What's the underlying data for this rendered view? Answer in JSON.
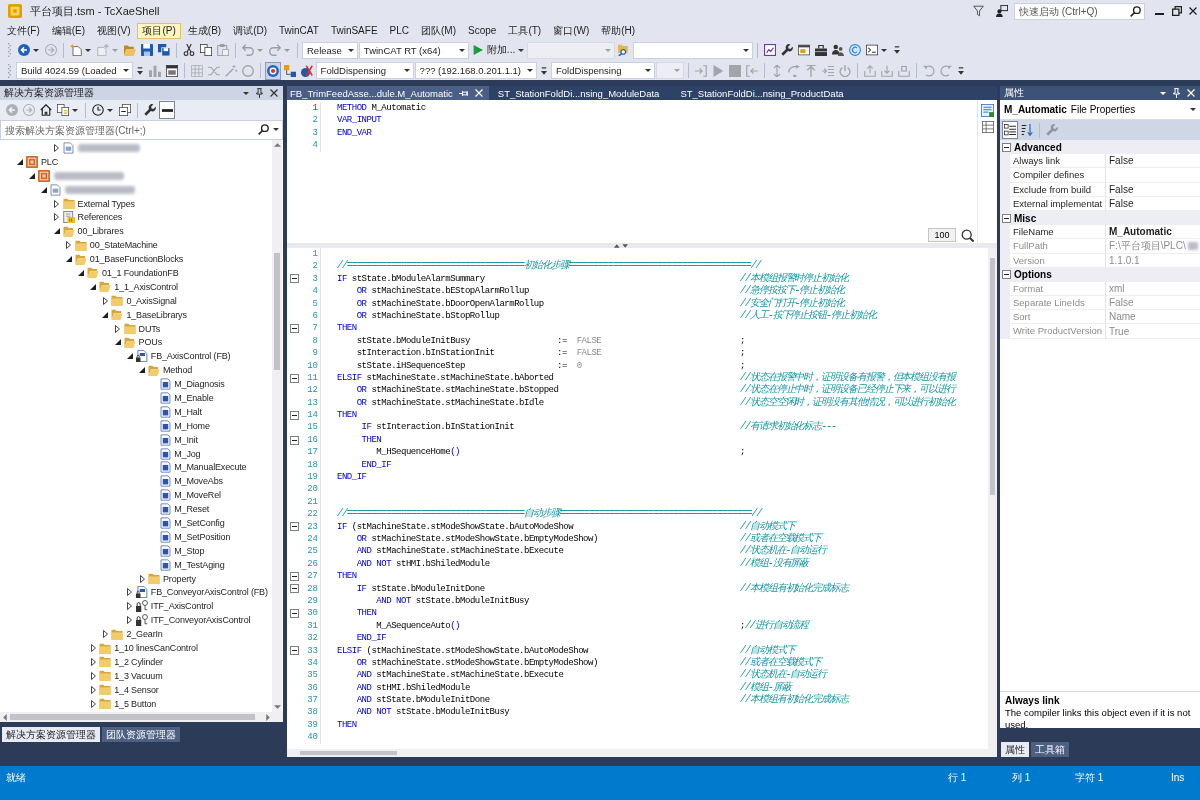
{
  "window": {
    "title": "平台项目.tsm - TcXaeShell",
    "quick_launch": {
      "placeholder": "快速启动 (Ctrl+Q)"
    }
  },
  "menu": [
    {
      "label": "文件(F)",
      "selected": false
    },
    {
      "label": "编辑(E)",
      "selected": false
    },
    {
      "label": "视图(V)",
      "selected": false
    },
    {
      "label": "项目(P)",
      "selected": true
    },
    {
      "label": "生成(B)",
      "selected": false
    },
    {
      "label": "调试(D)",
      "selected": false
    },
    {
      "label": "TwinCAT",
      "selected": false
    },
    {
      "label": "TwinSAFE",
      "selected": false
    },
    {
      "label": "PLC",
      "selected": false
    },
    {
      "label": "团队(M)",
      "selected": false
    },
    {
      "label": "Scope",
      "selected": false
    },
    {
      "label": "工具(T)",
      "selected": false
    },
    {
      "label": "窗口(W)",
      "selected": false
    },
    {
      "label": "帮助(H)",
      "selected": false
    }
  ],
  "toolbar_1": [
    {
      "kind": "split",
      "disabled": false
    },
    {
      "kind": "button",
      "disabled": true
    },
    {
      "kind": "separator"
    },
    {
      "kind": "split",
      "disabled": false
    },
    {
      "kind": "split",
      "disabled": true
    },
    {
      "kind": "button",
      "disabled": false
    },
    {
      "kind": "button",
      "disabled": false
    },
    {
      "kind": "button",
      "disabled": false
    },
    {
      "kind": "separator"
    },
    {
      "kind": "button",
      "disabled": false
    },
    {
      "kind": "button",
      "disabled": false
    },
    {
      "kind": "button",
      "disabled": true
    },
    {
      "kind": "separator"
    },
    {
      "kind": "split",
      "disabled": true
    },
    {
      "kind": "split",
      "disabled": true
    },
    {
      "kind": "separator"
    },
    {
      "kind": "dropdown",
      "value": "Release",
      "disabled": false
    },
    {
      "kind": "dropdown",
      "value": "TwinCAT RT (x64)",
      "disabled": false
    },
    {
      "kind": "start",
      "label": "附加...",
      "disabled": false
    },
    {
      "kind": "dropdown",
      "disabled": true
    },
    {
      "kind": "button",
      "disabled": false
    },
    {
      "kind": "dropdown",
      "disabled": false
    },
    {
      "kind": "separator"
    },
    {
      "kind": "button",
      "disabled": false
    },
    {
      "kind": "button",
      "disabled": false
    },
    {
      "kind": "button",
      "disabled": false
    },
    {
      "kind": "button",
      "disabled": false
    },
    {
      "kind": "button",
      "disabled": false
    },
    {
      "kind": "button",
      "disabled": false
    },
    {
      "kind": "split",
      "disabled": false
    },
    {
      "kind": "overflow"
    }
  ],
  "toolbar_2": [
    {
      "kind": "dropdown",
      "value": "Build 4024.59 (Loaded",
      "disabled": false
    },
    {
      "kind": "overflow"
    },
    {
      "kind": "button",
      "disabled": true,
      "pressed": false
    },
    {
      "kind": "button",
      "disabled": false,
      "pressed": false
    },
    {
      "kind": "separator"
    },
    {
      "kind": "button",
      "disabled": true,
      "pressed": false
    },
    {
      "kind": "button",
      "disabled": true,
      "pressed": false
    },
    {
      "kind": "button",
      "disabled": true,
      "pressed": false
    },
    {
      "kind": "button",
      "disabled": true,
      "pressed": false
    },
    {
      "kind": "separator"
    },
    {
      "kind": "button",
      "disabled": false,
      "pressed": true
    },
    {
      "kind": "button",
      "disabled": false,
      "pressed": false
    },
    {
      "kind": "button",
      "disabled": false,
      "pressed": false
    },
    {
      "kind": "dropdown",
      "value": "FoldDispensing",
      "disabled": false
    },
    {
      "kind": "dropdown",
      "value": "??? (192.168.0.201.1.1)",
      "disabled": false
    },
    {
      "kind": "overflow"
    },
    {
      "kind": "dropdown",
      "value": "FoldDispensing",
      "disabled": false
    },
    {
      "kind": "dropdown",
      "disabled": true
    },
    {
      "kind": "separator"
    },
    {
      "kind": "button",
      "disabled": true,
      "pressed": false
    },
    {
      "kind": "button",
      "disabled": true,
      "pressed": false
    },
    {
      "kind": "button",
      "disabled": true,
      "pressed": false
    },
    {
      "kind": "button",
      "disabled": true,
      "pressed": false
    },
    {
      "kind": "separator"
    },
    {
      "kind": "button",
      "disabled": true,
      "pressed": false
    },
    {
      "kind": "button",
      "disabled": true,
      "pressed": false
    },
    {
      "kind": "button",
      "disabled": true,
      "pressed": false
    },
    {
      "kind": "button",
      "disabled": true,
      "pressed": false
    },
    {
      "kind": "button",
      "disabled": true,
      "pressed": false
    },
    {
      "kind": "separator"
    },
    {
      "kind": "button",
      "disabled": true,
      "pressed": false
    },
    {
      "kind": "button",
      "disabled": true,
      "pressed": false
    },
    {
      "kind": "button",
      "disabled": true,
      "pressed": false
    },
    {
      "kind": "separator"
    },
    {
      "kind": "button",
      "disabled": true,
      "pressed": false
    },
    {
      "kind": "button",
      "disabled": true,
      "pressed": false
    },
    {
      "kind": "overflow"
    }
  ],
  "solution_explorer": {
    "title": "解决方案资源管理器",
    "toolbar": [
      {
        "kind": "button",
        "disabled": true,
        "pressed": false
      },
      {
        "kind": "button",
        "disabled": true,
        "pressed": false
      },
      {
        "kind": "button",
        "disabled": false,
        "pressed": false
      },
      {
        "kind": "split",
        "disabled": false,
        "pressed": false
      },
      {
        "kind": "separator"
      },
      {
        "kind": "split",
        "disabled": false,
        "pressed": false
      },
      {
        "kind": "button",
        "disabled": false,
        "pressed": false
      },
      {
        "kind": "separator"
      },
      {
        "kind": "button",
        "disabled": false,
        "pressed": false
      },
      {
        "kind": "button",
        "disabled": false,
        "pressed": true
      }
    ],
    "search": {
      "placeholder": "搜索解决方案资源管理器(Ctrl+;)"
    },
    "tree_top_item": {
      "kind": "document",
      "blurred": true,
      "expanded": false
    },
    "tree": [
      {
        "label": "PLC",
        "kind": "plc",
        "expanded": true,
        "children": [
          {
            "kind": "plc_project",
            "blurred": true,
            "expanded": true,
            "children": [
              {
                "kind": "document",
                "blurred": true,
                "expanded": true,
                "children": [
                  {
                    "label": "External Types",
                    "kind": "folder",
                    "expanded": false
                  },
                  {
                    "label": "References",
                    "kind": "references",
                    "expanded": false
                  },
                  {
                    "label": "00_Librares",
                    "kind": "folder",
                    "expanded": true,
                    "children": [
                      {
                        "label": "00_StateMachine",
                        "kind": "folder",
                        "expanded": false
                      },
                      {
                        "label": "01_BaseFunctionBlocks",
                        "kind": "folder",
                        "expanded": true,
                        "children": [
                          {
                            "label": "01_1 FoundationFB",
                            "kind": "folder",
                            "expanded": true,
                            "children": [
                              {
                                "label": "1_1_AxisControl",
                                "kind": "folder",
                                "expanded": true,
                                "children": [
                                  {
                                    "label": "0_AxisSignal",
                                    "kind": "folder",
                                    "expanded": false
                                  },
                                  {
                                    "label": "1_BaseLibrarys",
                                    "kind": "folder",
                                    "expanded": true,
                                    "children": [
                                      {
                                        "label": "DUTs",
                                        "kind": "folder",
                                        "expanded": false
                                      },
                                      {
                                        "label": "POUs",
                                        "kind": "folder",
                                        "expanded": true,
                                        "children": [
                                          {
                                            "label": "FB_AxisControl (FB)",
                                            "kind": "fb",
                                            "expanded": true,
                                            "children": [
                                              {
                                                "label": "Method",
                                                "kind": "folder",
                                                "expanded": true,
                                                "children": [
                                                  {
                                                    "label": "M_Diagnosis",
                                                    "kind": "method"
                                                  },
                                                  {
                                                    "label": "M_Enable",
                                                    "kind": "method"
                                                  },
                                                  {
                                                    "label": "M_Halt",
                                                    "kind": "method"
                                                  },
                                                  {
                                                    "label": "M_Home",
                                                    "kind": "method"
                                                  },
                                                  {
                                                    "label": "M_Init",
                                                    "kind": "method"
                                                  },
                                                  {
                                                    "label": "M_Jog",
                                                    "kind": "method"
                                                  },
                                                  {
                                                    "label": "M_ManualExecute",
                                                    "kind": "method"
                                                  },
                                                  {
                                                    "label": "M_MoveAbs",
                                                    "kind": "method"
                                                  },
                                                  {
                                                    "label": "M_MoveRel",
                                                    "kind": "method"
                                                  },
                                                  {
                                                    "label": "M_Reset",
                                                    "kind": "method"
                                                  },
                                                  {
                                                    "label": "M_SetConfig",
                                                    "kind": "method"
                                                  },
                                                  {
                                                    "label": "M_SetPosition",
                                                    "kind": "method"
                                                  },
                                                  {
                                                    "label": "M_Stop",
                                                    "kind": "method"
                                                  },
                                                  {
                                                    "label": "M_TestAging",
                                                    "kind": "method"
                                                  }
                                                ]
                                              },
                                              {
                                                "label": "Property",
                                                "kind": "folder",
                                                "expanded": false
                                              }
                                            ]
                                          },
                                          {
                                            "label": "FB_ConveyorAxisControl (FB)",
                                            "kind": "fb",
                                            "expanded": false
                                          },
                                          {
                                            "label": "ITF_AxisControl",
                                            "kind": "interface",
                                            "expanded": false
                                          },
                                          {
                                            "label": "ITF_ConveyorAxisControl",
                                            "kind": "interface",
                                            "expanded": false
                                          }
                                        ]
                                      }
                                    ]
                                  },
                                  {
                                    "label": "2_GearIn",
                                    "kind": "folder",
                                    "expanded": false
                                  }
                                ]
                              },
                              {
                                "label": "1_10 linesCanControl",
                                "kind": "folder",
                                "expanded": false
                              },
                              {
                                "label": "1_2 Cylinder",
                                "kind": "folder",
                                "expanded": false
                              },
                              {
                                "label": "1_3 Vacuum",
                                "kind": "folder",
                                "expanded": false
                              },
                              {
                                "label": "1_4 Sensor",
                                "kind": "folder",
                                "expanded": false
                              },
                              {
                                "label": "1_5 Button",
                                "kind": "folder",
                                "expanded": false
                              }
                            ]
                          }
                        ]
                      }
                    ]
                  }
                ]
              }
            ]
          }
        ]
      }
    ],
    "tabs": [
      {
        "label": "解决方案资源管理器",
        "selected": true
      },
      {
        "label": "团队资源管理器",
        "selected": false
      }
    ]
  },
  "editor": {
    "tabs": [
      {
        "label": "FB_TrimFeedAsse...dule.M_Automatic",
        "selected": true
      },
      {
        "label": "ST_StationFoldDi...nsing_ModuleData",
        "selected": false
      },
      {
        "label": "ST_StationFoldDi...nsing_ProductData",
        "selected": false
      }
    ],
    "declaration": {
      "zoom": "100",
      "lines": [
        {
          "number": "1",
          "current": true,
          "code": [
            {
              "kind": "keyword",
              "text": "METHOD"
            },
            {
              "kind": "plain",
              "text": " M_Automatic"
            }
          ]
        },
        {
          "number": "2",
          "current": false,
          "code": [
            {
              "kind": "keyword",
              "text": "VAR_INPUT"
            }
          ]
        },
        {
          "number": "3",
          "current": false,
          "code": [
            {
              "kind": "keyword",
              "text": "END_VAR"
            }
          ]
        },
        {
          "number": "4",
          "current": false
        }
      ]
    },
    "implementation": {
      "lines": [
        {
          "number": "1",
          "foldable": false
        },
        {
          "number": "2",
          "foldable": false,
          "code": [
            {
              "kind": "comment",
              "text": "//====================================初始化步骤=====================================//"
            }
          ]
        },
        {
          "number": "3",
          "foldable": true,
          "code": [
            {
              "kind": "keyword",
              "text": "IF"
            },
            {
              "kind": "plain",
              "text": " stState.bModuleAlarmSummary"
            }
          ],
          "tail": [
            {
              "kind": "comment",
              "text": "//本模组报警时停止初始化"
            }
          ]
        },
        {
          "number": "4",
          "foldable": false,
          "code": [
            {
              "kind": "keyword",
              "text": "    OR"
            },
            {
              "kind": "plain",
              "text": " stMachineState.bEStopAlarmRollup"
            }
          ],
          "tail": [
            {
              "kind": "comment",
              "text": "//急停按按下-停止初始化"
            }
          ]
        },
        {
          "number": "5",
          "foldable": false,
          "code": [
            {
              "kind": "keyword",
              "text": "    OR"
            },
            {
              "kind": "plain",
              "text": " stMachineState.bDoorOpenAlarmRollup"
            }
          ],
          "tail": [
            {
              "kind": "comment",
              "text": "//安全门打开-停止初始化"
            }
          ]
        },
        {
          "number": "6",
          "foldable": false,
          "code": [
            {
              "kind": "keyword",
              "text": "    OR"
            },
            {
              "kind": "plain",
              "text": " stMachineState.bStopRollup"
            }
          ],
          "tail": [
            {
              "kind": "comment",
              "text": "//人工-按下停止按钮-停止初始化"
            }
          ]
        },
        {
          "number": "7",
          "foldable": true,
          "code": [
            {
              "kind": "keyword",
              "text": "THEN"
            }
          ]
        },
        {
          "number": "8",
          "foldable": false,
          "code": [
            {
              "kind": "plain",
              "text": "    stState.bModuleInitBusy"
            }
          ],
          "value": [
            {
              "kind": "plain",
              "text": ":=  "
            },
            {
              "kind": "literal",
              "text": "FALSE"
            }
          ],
          "tail": [
            {
              "kind": "plain",
              "text": ";"
            }
          ]
        },
        {
          "number": "9",
          "foldable": false,
          "code": [
            {
              "kind": "plain",
              "text": "    stInteraction.bInStationInit"
            }
          ],
          "value": [
            {
              "kind": "plain",
              "text": ":=  "
            },
            {
              "kind": "literal",
              "text": "FALSE"
            }
          ],
          "tail": [
            {
              "kind": "plain",
              "text": ";"
            }
          ]
        },
        {
          "number": "10",
          "foldable": false,
          "code": [
            {
              "kind": "plain",
              "text": "    stState.iHSequenceStep"
            }
          ],
          "value": [
            {
              "kind": "plain",
              "text": ":=  "
            },
            {
              "kind": "literal",
              "text": "0"
            }
          ],
          "tail": [
            {
              "kind": "plain",
              "text": ";"
            }
          ]
        },
        {
          "number": "11",
          "foldable": true,
          "code": [
            {
              "kind": "keyword",
              "text": "ELSIF"
            },
            {
              "kind": "plain",
              "text": " stMachineState.stMachineState.bAborted"
            }
          ],
          "tail": [
            {
              "kind": "comment",
              "text": "//状态在报警中时，证明设备有报警，但本模组没有报"
            }
          ]
        },
        {
          "number": "12",
          "foldable": false,
          "code": [
            {
              "kind": "keyword",
              "text": "    OR"
            },
            {
              "kind": "plain",
              "text": " stMachineState.stMachineState.bStopped"
            }
          ],
          "tail": [
            {
              "kind": "comment",
              "text": "//状态在停止中时，证明设备已经停止下来，可以进行"
            }
          ]
        },
        {
          "number": "13",
          "foldable": false,
          "code": [
            {
              "kind": "keyword",
              "text": "    OR"
            },
            {
              "kind": "plain",
              "text": " stMachineState.stMachineState.bIdle"
            }
          ],
          "tail": [
            {
              "kind": "comment",
              "text": "//状态空空闲时，证明没有其他情况，可以进行初始化"
            }
          ]
        },
        {
          "number": "14",
          "foldable": true,
          "code": [
            {
              "kind": "keyword",
              "text": "THEN"
            }
          ]
        },
        {
          "number": "15",
          "foldable": false,
          "code": [
            {
              "kind": "keyword",
              "text": "     IF"
            },
            {
              "kind": "plain",
              "text": " stInteraction.bInStationInit"
            }
          ],
          "tail": [
            {
              "kind": "comment",
              "text": "//有请求初始化标志---"
            }
          ]
        },
        {
          "number": "16",
          "foldable": true,
          "code": [
            {
              "kind": "keyword",
              "text": "     THEN"
            }
          ]
        },
        {
          "number": "17",
          "foldable": false,
          "code": [
            {
              "kind": "plain",
              "text": "        M_HSequenceHome"
            },
            {
              "kind": "keyword",
              "text": "()"
            }
          ],
          "tail": [
            {
              "kind": "plain",
              "text": ";"
            }
          ]
        },
        {
          "number": "18",
          "foldable": false,
          "code": [
            {
              "kind": "keyword",
              "text": "     END_IF"
            }
          ]
        },
        {
          "number": "19",
          "foldable": false,
          "code": [
            {
              "kind": "keyword",
              "text": "END_IF"
            }
          ]
        },
        {
          "number": "20",
          "foldable": false
        },
        {
          "number": "21",
          "foldable": false
        },
        {
          "number": "22",
          "foldable": false,
          "code": [
            {
              "kind": "comment",
              "text": "//====================================自动步骤=======================================//"
            }
          ]
        },
        {
          "number": "23",
          "foldable": true,
          "code": [
            {
              "kind": "keyword",
              "text": "IF"
            },
            {
              "kind": "plain",
              "text": " (stMachineState.stModeShowState.bAutoModeShow"
            }
          ],
          "tail": [
            {
              "kind": "comment",
              "text": "//自动模式下"
            }
          ]
        },
        {
          "number": "24",
          "foldable": false,
          "code": [
            {
              "kind": "keyword",
              "text": "    OR"
            },
            {
              "kind": "plain",
              "text": " stMachineState.stModeShowState.bEmptyModeShow)"
            }
          ],
          "tail": [
            {
              "kind": "comment",
              "text": "//或者在空载模式下"
            }
          ]
        },
        {
          "number": "25",
          "foldable": false,
          "code": [
            {
              "kind": "keyword",
              "text": "    AND"
            },
            {
              "kind": "plain",
              "text": " stMachineState.stMachineState.bExecute"
            }
          ],
          "tail": [
            {
              "kind": "comment",
              "text": "//状态机在-自动运行"
            }
          ]
        },
        {
          "number": "26",
          "foldable": false,
          "code": [
            {
              "kind": "keyword",
              "text": "    AND NOT"
            },
            {
              "kind": "plain",
              "text": " stHMI.bShiledModule"
            }
          ],
          "tail": [
            {
              "kind": "comment",
              "text": "//模组-没有屏蔽"
            }
          ]
        },
        {
          "number": "27",
          "foldable": true,
          "code": [
            {
              "kind": "keyword",
              "text": "THEN"
            }
          ]
        },
        {
          "number": "28",
          "foldable": true,
          "code": [
            {
              "kind": "keyword",
              "text": "    IF"
            },
            {
              "kind": "plain",
              "text": " stState.bModuleInitDone"
            }
          ],
          "tail": [
            {
              "kind": "comment",
              "text": "//本模组有初始化完成标志"
            }
          ]
        },
        {
          "number": "29",
          "foldable": false,
          "code": [
            {
              "kind": "keyword",
              "text": "        AND NOT"
            },
            {
              "kind": "plain",
              "text": " stState.bModuleInitBusy"
            }
          ]
        },
        {
          "number": "30",
          "foldable": true,
          "code": [
            {
              "kind": "keyword",
              "text": "    THEN"
            }
          ]
        },
        {
          "number": "31",
          "foldable": false,
          "code": [
            {
              "kind": "plain",
              "text": "        M_ASequenceAuto"
            },
            {
              "kind": "keyword",
              "text": "()"
            }
          ],
          "tail": [
            {
              "kind": "plain",
              "text": ";"
            },
            {
              "kind": "comment",
              "text": "//进行自动流程"
            }
          ]
        },
        {
          "number": "32",
          "foldable": false,
          "code": [
            {
              "kind": "keyword",
              "text": "    END_IF"
            }
          ]
        },
        {
          "number": "33",
          "foldable": true,
          "code": [
            {
              "kind": "keyword",
              "text": "ELSIF"
            },
            {
              "kind": "plain",
              "text": " (stMachineState.stModeShowState.bAutoModeShow"
            }
          ],
          "tail": [
            {
              "kind": "comment",
              "text": "//自动模式下"
            }
          ]
        },
        {
          "number": "34",
          "foldable": false,
          "code": [
            {
              "kind": "keyword",
              "text": "    OR"
            },
            {
              "kind": "plain",
              "text": " stMachineState.stModeShowState.bEmptyModeShow)"
            }
          ],
          "tail": [
            {
              "kind": "comment",
              "text": "//或者在空载模式下"
            }
          ]
        },
        {
          "number": "35",
          "foldable": false,
          "code": [
            {
              "kind": "keyword",
              "text": "    AND"
            },
            {
              "kind": "plain",
              "text": " stMachineState.stMachineState.bExecute"
            }
          ],
          "tail": [
            {
              "kind": "comment",
              "text": "//状态机在-自动运行"
            }
          ]
        },
        {
          "number": "36",
          "foldable": false,
          "code": [
            {
              "kind": "keyword",
              "text": "    AND"
            },
            {
              "kind": "plain",
              "text": " stHMI.bShiledModule"
            }
          ],
          "tail": [
            {
              "kind": "comment",
              "text": "//模组-屏蔽"
            }
          ]
        },
        {
          "number": "37",
          "foldable": false,
          "code": [
            {
              "kind": "keyword",
              "text": "    AND"
            },
            {
              "kind": "plain",
              "text": " stState.bModuleInitDone"
            }
          ],
          "tail": [
            {
              "kind": "comment",
              "text": "//本模组有初始化完成标志"
            }
          ]
        },
        {
          "number": "38",
          "foldable": false,
          "code": [
            {
              "kind": "keyword",
              "text": "    AND NOT"
            },
            {
              "kind": "plain",
              "text": " stState.bModuleInitBusy"
            }
          ]
        },
        {
          "number": "39",
          "foldable": false,
          "code": [
            {
              "kind": "keyword",
              "text": "THEN"
            }
          ]
        },
        {
          "number": "40",
          "foldable": false
        }
      ]
    }
  },
  "properties": {
    "title": "属性",
    "object": {
      "name": "M_Automatic",
      "type": "File Properties"
    },
    "toolbar": [
      {
        "kind": "button",
        "disabled": false,
        "pressed": true
      },
      {
        "kind": "button",
        "disabled": false,
        "pressed": false
      },
      {
        "kind": "separator"
      },
      {
        "kind": "button",
        "disabled": true,
        "pressed": false
      }
    ],
    "categories": [
      {
        "name": "Advanced",
        "expanded": true,
        "rows": [
          {
            "name": "Always link",
            "value": "False",
            "readonly": false,
            "modified": false
          },
          {
            "name": "Compiler defines",
            "readonly": false
          },
          {
            "name": "Exclude from build",
            "value": "False",
            "readonly": false,
            "modified": false
          },
          {
            "name": "External implementat",
            "value": "False",
            "readonly": false,
            "modified": false
          }
        ]
      },
      {
        "name": "Misc",
        "expanded": true,
        "rows": [
          {
            "name": "FileName",
            "value": "M_Automatic",
            "readonly": false,
            "modified": true
          },
          {
            "name": "FullPath",
            "value": "F:\\平台项目\\PLC\\",
            "readonly": true,
            "modified": false,
            "blurred": true
          },
          {
            "name": "Version",
            "value": "1.1.0.1",
            "readonly": true,
            "modified": false
          }
        ]
      },
      {
        "name": "Options",
        "expanded": true,
        "rows": [
          {
            "name": "Format",
            "value": "xml",
            "readonly": true,
            "modified": false
          },
          {
            "name": "Separate LineIds",
            "value": "False",
            "readonly": true,
            "modified": false
          },
          {
            "name": "Sort",
            "value": "Name",
            "readonly": true,
            "modified": false
          },
          {
            "name": "Write ProductVersion",
            "value": "True",
            "readonly": true,
            "modified": false
          }
        ]
      }
    ],
    "description": {
      "title": "Always link",
      "text": "The compiler links this object even if it is not used."
    },
    "tabs": [
      {
        "label": "属性",
        "selected": true
      },
      {
        "label": "工具箱",
        "selected": false
      }
    ]
  },
  "status_bar": {
    "message": "就绪",
    "line": "行 1",
    "column": "列 1",
    "character": "字符 1",
    "mode": "Ins"
  }
}
